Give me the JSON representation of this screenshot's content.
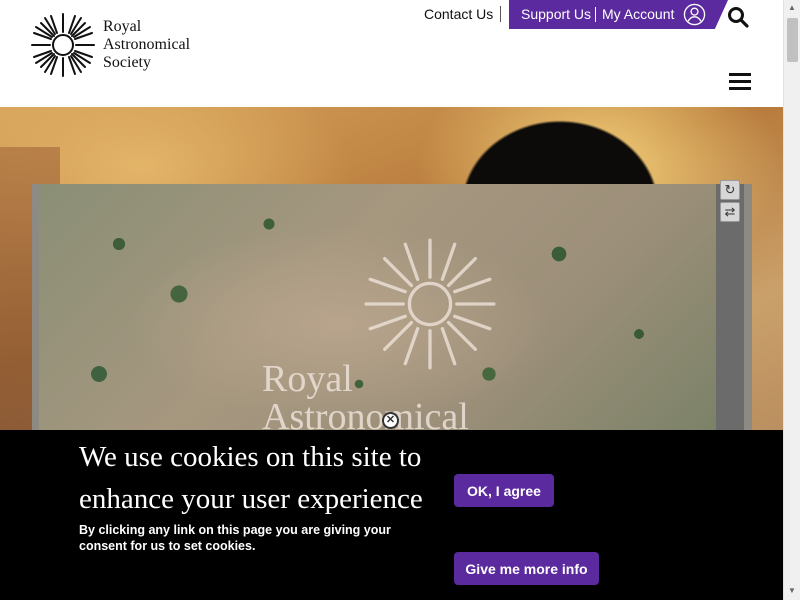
{
  "brand": {
    "name_lines": [
      "Royal",
      "Astronomical",
      "Society"
    ],
    "logo_icon": "sunburst-logo-icon",
    "accent_color": "#5b2a9e"
  },
  "header": {
    "contact_label": "Contact Us",
    "support_label": "Support Us",
    "account_label": "My Account",
    "icons": [
      "user-icon",
      "search-icon",
      "menu-icon"
    ]
  },
  "video": {
    "watermark_lines": [
      "Royal",
      "Astronomical"
    ],
    "controls": [
      "reload-icon",
      "refresh-icon",
      "close-icon"
    ]
  },
  "cookie_banner": {
    "title": "We use cookies on this site to enhance your user experience",
    "text": "By clicking any link on this page you are giving your consent for us to set cookies.",
    "agree_label": "OK, I agree",
    "info_label": "Give me more info"
  }
}
